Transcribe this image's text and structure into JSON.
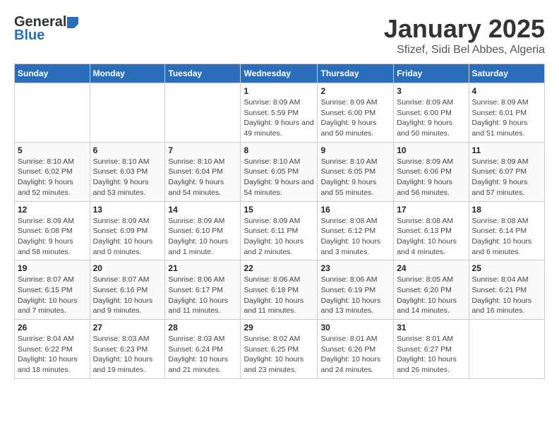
{
  "logo": {
    "general": "General",
    "blue": "Blue"
  },
  "header": {
    "title": "January 2025",
    "subtitle": "Sfizef, Sidi Bel Abbes, Algeria"
  },
  "weekdays": [
    "Sunday",
    "Monday",
    "Tuesday",
    "Wednesday",
    "Thursday",
    "Friday",
    "Saturday"
  ],
  "weeks": [
    [
      {
        "day": "",
        "info": ""
      },
      {
        "day": "",
        "info": ""
      },
      {
        "day": "",
        "info": ""
      },
      {
        "day": "1",
        "info": "Sunrise: 8:09 AM\nSunset: 5:59 PM\nDaylight: 9 hours and 49 minutes."
      },
      {
        "day": "2",
        "info": "Sunrise: 8:09 AM\nSunset: 6:00 PM\nDaylight: 9 hours and 50 minutes."
      },
      {
        "day": "3",
        "info": "Sunrise: 8:09 AM\nSunset: 6:00 PM\nDaylight: 9 hours and 50 minutes."
      },
      {
        "day": "4",
        "info": "Sunrise: 8:09 AM\nSunset: 6:01 PM\nDaylight: 9 hours and 51 minutes."
      }
    ],
    [
      {
        "day": "5",
        "info": "Sunrise: 8:10 AM\nSunset: 6:02 PM\nDaylight: 9 hours and 52 minutes."
      },
      {
        "day": "6",
        "info": "Sunrise: 8:10 AM\nSunset: 6:03 PM\nDaylight: 9 hours and 53 minutes."
      },
      {
        "day": "7",
        "info": "Sunrise: 8:10 AM\nSunset: 6:04 PM\nDaylight: 9 hours and 54 minutes."
      },
      {
        "day": "8",
        "info": "Sunrise: 8:10 AM\nSunset: 6:05 PM\nDaylight: 9 hours and 54 minutes."
      },
      {
        "day": "9",
        "info": "Sunrise: 8:10 AM\nSunset: 6:05 PM\nDaylight: 9 hours and 55 minutes."
      },
      {
        "day": "10",
        "info": "Sunrise: 8:09 AM\nSunset: 6:06 PM\nDaylight: 9 hours and 56 minutes."
      },
      {
        "day": "11",
        "info": "Sunrise: 8:09 AM\nSunset: 6:07 PM\nDaylight: 9 hours and 57 minutes."
      }
    ],
    [
      {
        "day": "12",
        "info": "Sunrise: 8:09 AM\nSunset: 6:08 PM\nDaylight: 9 hours and 58 minutes."
      },
      {
        "day": "13",
        "info": "Sunrise: 8:09 AM\nSunset: 6:09 PM\nDaylight: 10 hours and 0 minutes."
      },
      {
        "day": "14",
        "info": "Sunrise: 8:09 AM\nSunset: 6:10 PM\nDaylight: 10 hours and 1 minute."
      },
      {
        "day": "15",
        "info": "Sunrise: 8:09 AM\nSunset: 6:11 PM\nDaylight: 10 hours and 2 minutes."
      },
      {
        "day": "16",
        "info": "Sunrise: 8:08 AM\nSunset: 6:12 PM\nDaylight: 10 hours and 3 minutes."
      },
      {
        "day": "17",
        "info": "Sunrise: 8:08 AM\nSunset: 6:13 PM\nDaylight: 10 hours and 4 minutes."
      },
      {
        "day": "18",
        "info": "Sunrise: 8:08 AM\nSunset: 6:14 PM\nDaylight: 10 hours and 6 minutes."
      }
    ],
    [
      {
        "day": "19",
        "info": "Sunrise: 8:07 AM\nSunset: 6:15 PM\nDaylight: 10 hours and 7 minutes."
      },
      {
        "day": "20",
        "info": "Sunrise: 8:07 AM\nSunset: 6:16 PM\nDaylight: 10 hours and 9 minutes."
      },
      {
        "day": "21",
        "info": "Sunrise: 8:06 AM\nSunset: 6:17 PM\nDaylight: 10 hours and 11 minutes."
      },
      {
        "day": "22",
        "info": "Sunrise: 8:06 AM\nSunset: 6:18 PM\nDaylight: 10 hours and 11 minutes."
      },
      {
        "day": "23",
        "info": "Sunrise: 8:06 AM\nSunset: 6:19 PM\nDaylight: 10 hours and 13 minutes."
      },
      {
        "day": "24",
        "info": "Sunrise: 8:05 AM\nSunset: 6:20 PM\nDaylight: 10 hours and 14 minutes."
      },
      {
        "day": "25",
        "info": "Sunrise: 8:04 AM\nSunset: 6:21 PM\nDaylight: 10 hours and 16 minutes."
      }
    ],
    [
      {
        "day": "26",
        "info": "Sunrise: 8:04 AM\nSunset: 6:22 PM\nDaylight: 10 hours and 18 minutes."
      },
      {
        "day": "27",
        "info": "Sunrise: 8:03 AM\nSunset: 6:23 PM\nDaylight: 10 hours and 19 minutes."
      },
      {
        "day": "28",
        "info": "Sunrise: 8:03 AM\nSunset: 6:24 PM\nDaylight: 10 hours and 21 minutes."
      },
      {
        "day": "29",
        "info": "Sunrise: 8:02 AM\nSunset: 6:25 PM\nDaylight: 10 hours and 23 minutes."
      },
      {
        "day": "30",
        "info": "Sunrise: 8:01 AM\nSunset: 6:26 PM\nDaylight: 10 hours and 24 minutes."
      },
      {
        "day": "31",
        "info": "Sunrise: 8:01 AM\nSunset: 6:27 PM\nDaylight: 10 hours and 26 minutes."
      },
      {
        "day": "",
        "info": ""
      }
    ]
  ]
}
